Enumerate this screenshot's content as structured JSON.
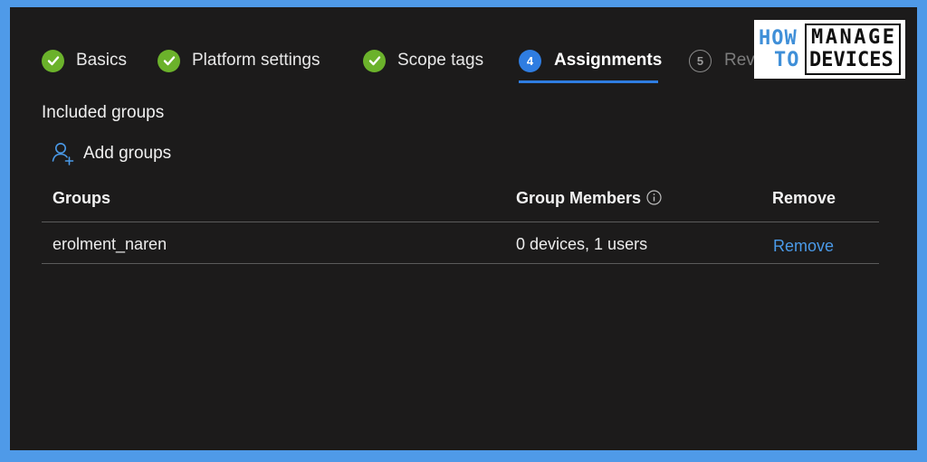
{
  "steps": [
    {
      "label": "Basics",
      "state": "complete"
    },
    {
      "label": "Platform settings",
      "state": "complete"
    },
    {
      "label": "Scope tags",
      "state": "complete"
    },
    {
      "label": "Assignments",
      "number": "4",
      "state": "active"
    },
    {
      "label": "Rev",
      "number": "5",
      "state": "upcoming"
    }
  ],
  "logo": {
    "line1": "HOW",
    "line2": "TO",
    "line3": "MANAGE",
    "line4": "DEVICES"
  },
  "section_title": "Included groups",
  "add_groups_label": "Add groups",
  "table": {
    "headers": [
      "Groups",
      "Group Members",
      "Remove"
    ],
    "rows": [
      {
        "group": "erolment_naren",
        "members": "0 devices, 1 users",
        "action": "Remove"
      }
    ]
  },
  "colors": {
    "accent": "#2f7de1",
    "complete": "#6bb22b",
    "link": "#4a9ae8",
    "background": "#1c1b1b",
    "frame": "#4f9ae8"
  },
  "icons": {
    "complete": "checkmark-circle-icon",
    "add_groups": "add-person-icon",
    "info": "info-icon"
  }
}
